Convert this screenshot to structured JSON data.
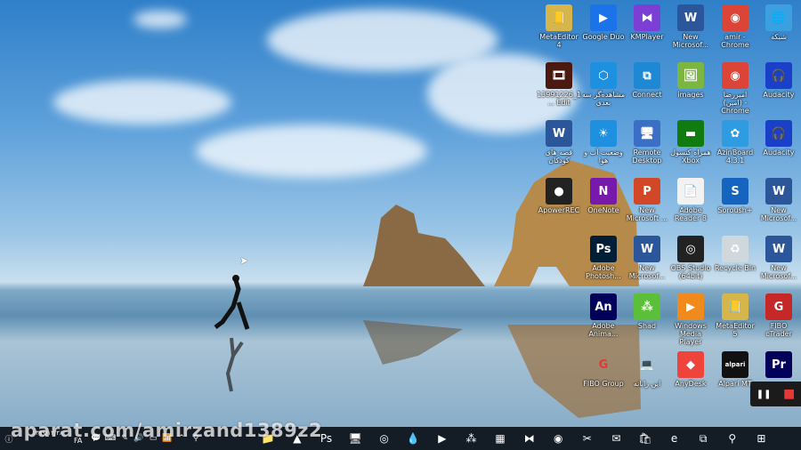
{
  "desktop": {
    "icons": [
      {
        "label": "MetaEditor 4",
        "glyph": "📒",
        "bg": "#d6b54a"
      },
      {
        "label": "Google Duo",
        "glyph": "▶",
        "bg": "#1a73e8"
      },
      {
        "label": "KMPlayer",
        "glyph": "⧓",
        "bg": "#7b3fd6"
      },
      {
        "label": "New Microsof...",
        "glyph": "W",
        "bg": "#2b579a"
      },
      {
        "label": "amir - Chrome",
        "glyph": "◉",
        "bg": "#db4437"
      },
      {
        "label": "شبکه",
        "glyph": "🌐",
        "bg": "#3aa0e0"
      },
      {
        "label": "13991226_1... Edit",
        "glyph": "🎞",
        "bg": "#4a1a10"
      },
      {
        "label": "مشاهده‌گر سه بعدی",
        "glyph": "⬡",
        "bg": "#1e90e0"
      },
      {
        "label": "Connect",
        "glyph": "⧉",
        "bg": "#1e88d4"
      },
      {
        "label": "images",
        "glyph": "🖼",
        "bg": "#7ab640"
      },
      {
        "label": "امیررضا (امین) - Chrome",
        "glyph": "◉",
        "bg": "#db4437"
      },
      {
        "label": "Audacity",
        "glyph": "🎧",
        "bg": "#1a3fc9"
      },
      {
        "label": "قصه های کودکان",
        "glyph": "W",
        "bg": "#2b579a"
      },
      {
        "label": "وضعیت آب و هوا",
        "glyph": "☀",
        "bg": "#1e90e0"
      },
      {
        "label": "Remote Desktop",
        "glyph": "🖥",
        "bg": "#3b6fc6"
      },
      {
        "label": "همراه کنسول Xbox",
        "glyph": "▬",
        "bg": "#107c10"
      },
      {
        "label": "AzinBoard 4.3.1",
        "glyph": "✿",
        "bg": "#2f9be0"
      },
      {
        "label": "Audacity",
        "glyph": "🎧",
        "bg": "#1a3fc9"
      },
      {
        "label": "ApowerREC",
        "glyph": "●",
        "bg": "#222"
      },
      {
        "label": "OneNote",
        "glyph": "N",
        "bg": "#7719aa"
      },
      {
        "label": "New Microsoft ...",
        "glyph": "P",
        "bg": "#d24726"
      },
      {
        "label": "Adobe Reader 8",
        "glyph": "📄",
        "bg": "#f2f2f2"
      },
      {
        "label": "Soroush+",
        "glyph": "S",
        "bg": "#1565c0"
      },
      {
        "label": "New Microsof...",
        "glyph": "W",
        "bg": "#2b579a"
      },
      {
        "label": "",
        "glyph": "",
        "bg": "transparent"
      },
      {
        "label": "Adobe Photosh...",
        "glyph": "Ps",
        "bg": "#001e36"
      },
      {
        "label": "New Microsof...",
        "glyph": "W",
        "bg": "#2b579a"
      },
      {
        "label": "OBS Studio (64bit)",
        "glyph": "◎",
        "bg": "#222"
      },
      {
        "label": "Recycle Bin",
        "glyph": "♻",
        "bg": "#cfd8dc"
      },
      {
        "label": "New Microsof...",
        "glyph": "W",
        "bg": "#2b579a"
      },
      {
        "label": "",
        "glyph": "",
        "bg": "transparent"
      },
      {
        "label": "Adobe Anima...",
        "glyph": "An",
        "bg": "#00005b"
      },
      {
        "label": "Shad",
        "glyph": "⁂",
        "bg": "#5cbf3a"
      },
      {
        "label": "Windows Media Player",
        "glyph": "▶",
        "bg": "#f08a1c"
      },
      {
        "label": "MetaEditor 5",
        "glyph": "📒",
        "bg": "#d6b54a"
      },
      {
        "label": "FIBO cTrader",
        "glyph": "G",
        "bg": "#c62828"
      },
      {
        "label": "",
        "glyph": "",
        "bg": "transparent"
      },
      {
        "label": "FIBO Group",
        "glyph": "G",
        "bg": "transparent"
      },
      {
        "label": "این رایانه",
        "glyph": "💻",
        "bg": "transparent"
      },
      {
        "label": "AnyDesk",
        "glyph": "◆",
        "bg": "#ef443b"
      },
      {
        "label": "Alpari MT",
        "glyph": "alpari",
        "bg": "#111"
      },
      {
        "label": "",
        "glyph": "Pr",
        "bg": "#00005b"
      }
    ]
  },
  "watermark": "aparat.com/amirzand1389z2",
  "recorder": {
    "pause": "❚❚",
    "stop": "■"
  },
  "taskbar": {
    "date": "۱۳۹۹/۱۲/۲۸",
    "lang": "FA",
    "tray": [
      "💬",
      "⌨",
      "✎",
      "🔊",
      "▭",
      "📶",
      "⌃",
      "⚲"
    ],
    "apps": [
      {
        "name": "file-explorer",
        "glyph": "📁"
      },
      {
        "name": "photos",
        "glyph": "▲"
      },
      {
        "name": "photoshop",
        "glyph": "Ps"
      },
      {
        "name": "connect",
        "glyph": "🖥"
      },
      {
        "name": "media",
        "glyph": "◎"
      },
      {
        "name": "paint",
        "glyph": "💧"
      },
      {
        "name": "duo",
        "glyph": "▶"
      },
      {
        "name": "shad",
        "glyph": "⁂"
      },
      {
        "name": "winrar",
        "glyph": "▦"
      },
      {
        "name": "kmplayer",
        "glyph": "⧓"
      },
      {
        "name": "chrome",
        "glyph": "◉"
      },
      {
        "name": "snip",
        "glyph": "✂"
      },
      {
        "name": "mail",
        "glyph": "✉"
      },
      {
        "name": "store",
        "glyph": "🛍"
      },
      {
        "name": "edge",
        "glyph": "e"
      },
      {
        "name": "task-view",
        "glyph": "⧉"
      },
      {
        "name": "search",
        "glyph": "⚲"
      },
      {
        "name": "start",
        "glyph": "⊞"
      }
    ]
  }
}
